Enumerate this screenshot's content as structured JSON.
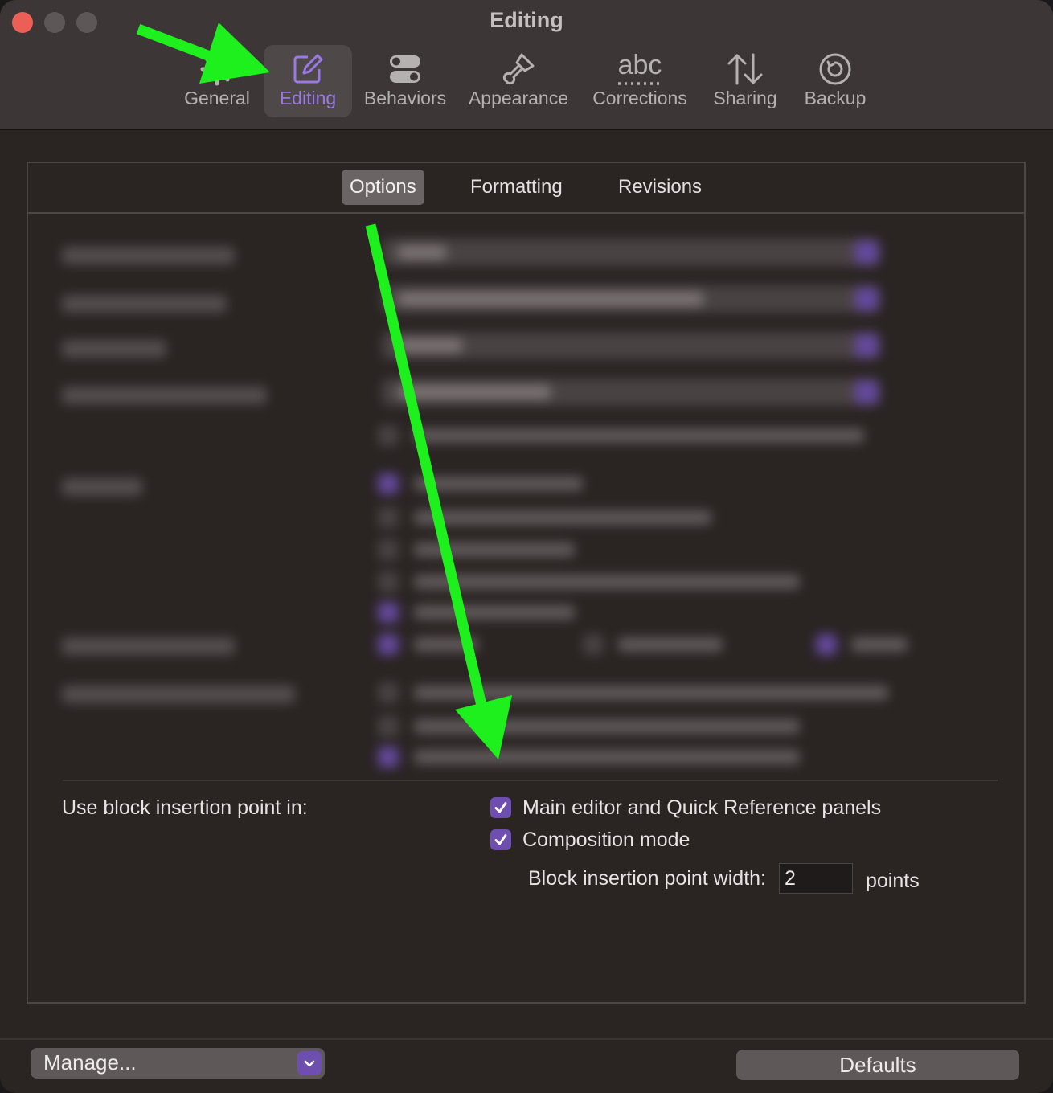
{
  "window": {
    "title": "Editing"
  },
  "toolbar": {
    "items": [
      {
        "label": "General",
        "icon": "gear-icon"
      },
      {
        "label": "Editing",
        "icon": "edit-icon",
        "active": true
      },
      {
        "label": "Behaviors",
        "icon": "toggles-icon"
      },
      {
        "label": "Appearance",
        "icon": "paintbrush-icon"
      },
      {
        "label": "Corrections",
        "icon": "abc-spellcheck-icon",
        "icon_text": "abc"
      },
      {
        "label": "Sharing",
        "icon": "up-down-arrows-icon"
      },
      {
        "label": "Backup",
        "icon": "clock-restore-icon"
      }
    ]
  },
  "tabs": [
    {
      "label": "Options",
      "selected": true
    },
    {
      "label": "Formatting"
    },
    {
      "label": "Revisions"
    }
  ],
  "block_insertion": {
    "label": "Use block insertion point in:",
    "options": [
      {
        "label": "Main editor and Quick Reference panels",
        "checked": true
      },
      {
        "label": "Composition mode",
        "checked": true
      }
    ],
    "width_label": "Block insertion point width:",
    "width_value": "2",
    "width_unit": "points"
  },
  "footer": {
    "manage_label": "Manage...",
    "defaults_label": "Defaults"
  },
  "colors": {
    "accent": "#6e4fb0",
    "active_tab_text": "#9b79e4",
    "annotation_arrow": "#1ef01e",
    "close_button": "#ec5f57"
  }
}
